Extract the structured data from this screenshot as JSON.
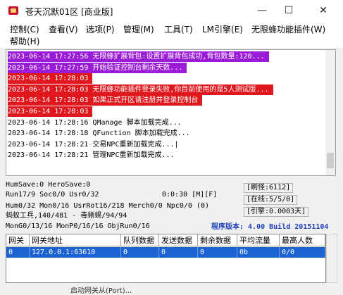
{
  "window": {
    "title": "苍天沉默01区 [商业版]",
    "minimize": "—",
    "maximize": "☐",
    "close": "✕"
  },
  "menu": [
    {
      "label": "控制(C)"
    },
    {
      "label": "查看(V)"
    },
    {
      "label": "选项(P)"
    },
    {
      "label": "管理(M)"
    },
    {
      "label": "工具(T)"
    },
    {
      "label": "LM引擎(E)"
    },
    {
      "label": "无限蜂功能插件(W)"
    },
    {
      "label": "帮助(H)"
    }
  ],
  "log": [
    {
      "text": "2023-06-14 17:27:56 无限蜂扩展背包:设置扩展背包成功,背包数量:120...",
      "bg": "#9b1cd6",
      "fg": "#ffffff"
    },
    {
      "text": "2023-06-14 17:27:59 开始验证控制台剩余天数...",
      "bg": "#9b1cd6",
      "fg": "#ffffff"
    },
    {
      "text": "2023-06-14 17:28:03",
      "bg": "#e0181e",
      "fg": "#ffffff"
    },
    {
      "text": "2023-06-14 17:28:03 无限蜂功能插件登录失败,你目前使用的是5人测试版...",
      "bg": "#e0181e",
      "fg": "#ffffff"
    },
    {
      "text": "2023-06-14 17:28:03 如果正式开区请注册并登录控制台",
      "bg": "#e0181e",
      "fg": "#ffffff"
    },
    {
      "text": "2023-06-14 17:28:03",
      "bg": "#e0181e",
      "fg": "#ffffff"
    },
    {
      "text": "2023-06-14 17:28:16 QManage 脚本加载完成...",
      "bg": "",
      "fg": "#000000"
    },
    {
      "text": "2023-06-14 17:28:18 QFunction 脚本加载完成...",
      "bg": "",
      "fg": "#000000"
    },
    {
      "text": "2023-06-14 17:28:21 交易NPC重新加载完成...|",
      "bg": "",
      "fg": "#000000"
    },
    {
      "text": "2023-06-14 17:28:21 管理NPC重新加载完成...",
      "bg": "",
      "fg": "#000000"
    }
  ],
  "status": {
    "line1": "HumSave:0 HeroSave:0",
    "line2": "Run17/9 Soc0/0 Usr0/32",
    "timer": "0:0:30 [M][F]",
    "line3": "Hum0/32 Mon0/16 UsrRot16/218 Merch0/0 Npc0/0 (0)",
    "line4": "蚂蚁工兵,140/481 - 毒蜥蜴/94/94",
    "line5": "MonG0/13/16 MonP0/16/16 ObjRun0/16",
    "refresh": "[刷怪:6112]",
    "online": "[在线:5/5/0]",
    "engine": "[引擎:0.0003天]",
    "version": "程序版本: 4.00 Build 20151104"
  },
  "table": {
    "headers": [
      "网关",
      "网关地址",
      "队列数据",
      "发送数据",
      "剩余数据",
      "平均流量",
      "最高人数"
    ],
    "rows": [
      [
        "0",
        "127.0.0.1:63610",
        "0",
        "0",
        "0",
        "0b",
        "0/0"
      ]
    ]
  },
  "bottom": "启动网关从(Port)..."
}
